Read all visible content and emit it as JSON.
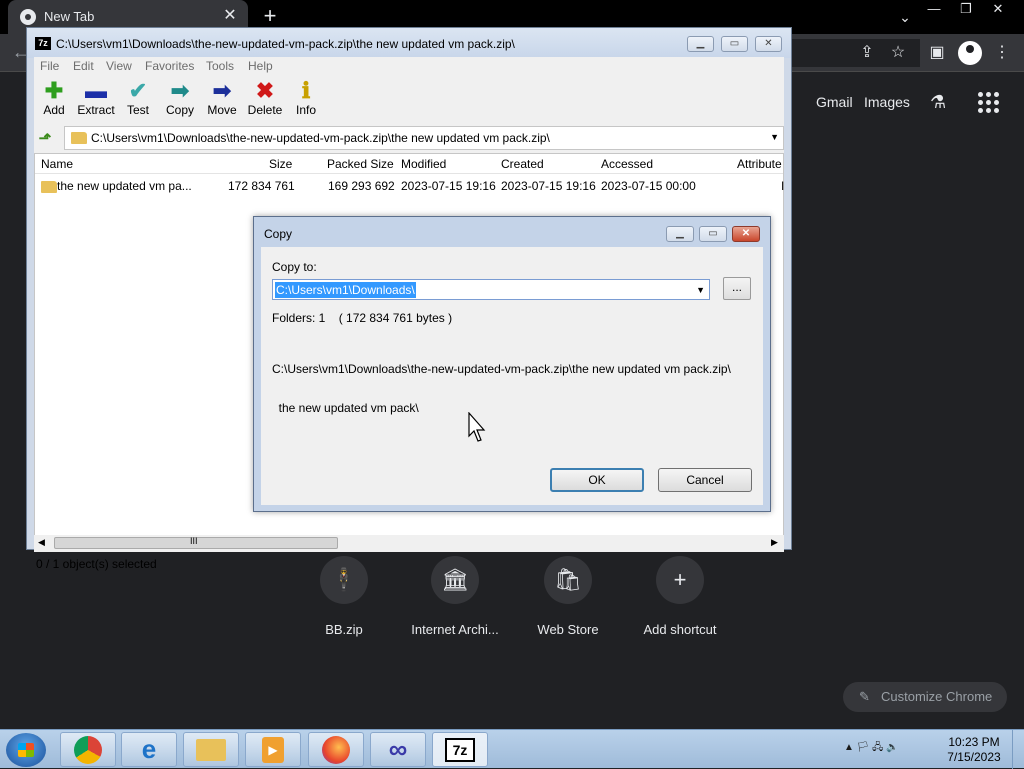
{
  "chrome": {
    "tab_title": "New Tab",
    "tab_close": "✕",
    "new_tab": "+",
    "gmail": "Gmail",
    "images": "Images",
    "shortcuts": [
      {
        "label": "BB.zip",
        "icon": "🕴"
      },
      {
        "label": "Internet Archi...",
        "icon": "🏛"
      },
      {
        "label": "Web Store",
        "icon": "🛍"
      },
      {
        "label": "Add shortcut",
        "icon": "+"
      }
    ],
    "customize": "Customize Chrome"
  },
  "zip": {
    "logo": "7z",
    "title": "C:\\Users\\vm1\\Downloads\\the-new-updated-vm-pack.zip\\the new updated vm pack.zip\\",
    "menu": [
      "File",
      "Edit",
      "View",
      "Favorites",
      "Tools",
      "Help"
    ],
    "tools": [
      {
        "label": "Add",
        "icon": "✚",
        "color": "#2e9e1e"
      },
      {
        "label": "Extract",
        "icon": "▬",
        "color": "#1c2fa8"
      },
      {
        "label": "Test",
        "icon": "✔",
        "color": "#3aa8a8"
      },
      {
        "label": "Copy",
        "icon": "➡",
        "color": "#1f8a8a"
      },
      {
        "label": "Move",
        "icon": "➡",
        "color": "#1c2f9a"
      },
      {
        "label": "Delete",
        "icon": "✖",
        "color": "#d01818"
      },
      {
        "label": "Info",
        "icon": "ℹ",
        "color": "#c8a000"
      }
    ],
    "address": "C:\\Users\\vm1\\Downloads\\the-new-updated-vm-pack.zip\\the new updated vm pack.zip\\",
    "columns": [
      "Name",
      "Size",
      "Packed Size",
      "Modified",
      "Created",
      "Accessed",
      "Attribute"
    ],
    "rows": [
      {
        "name": "the new updated vm pa...",
        "size": "172 834 761",
        "packed": "169 293 692",
        "modified": "2023-07-15 19:16",
        "created": "2023-07-15 19:16",
        "accessed": "2023-07-15 00:00",
        "attr": "I"
      }
    ],
    "hscroll_grip": "III",
    "status": "0 / 1 object(s) selected"
  },
  "copy_dialog": {
    "title": "Copy",
    "copy_to_label": "Copy to:",
    "copy_to_value": "C:\\Users\\vm1\\Downloads\\",
    "browse": "...",
    "folders_info": "Folders: 1    ( 172 834 761 bytes )",
    "path_line1": "C:\\Users\\vm1\\Downloads\\the-new-updated-vm-pack.zip\\the new updated vm pack.zip\\",
    "path_line2": "  the new updated vm pack\\",
    "ok": "OK",
    "cancel": "Cancel"
  },
  "taskbar": {
    "tray": "▲  🏳  🖧  🔈",
    "time": "10:23 PM",
    "date": "7/15/2023",
    "seven_zip": "7z"
  }
}
